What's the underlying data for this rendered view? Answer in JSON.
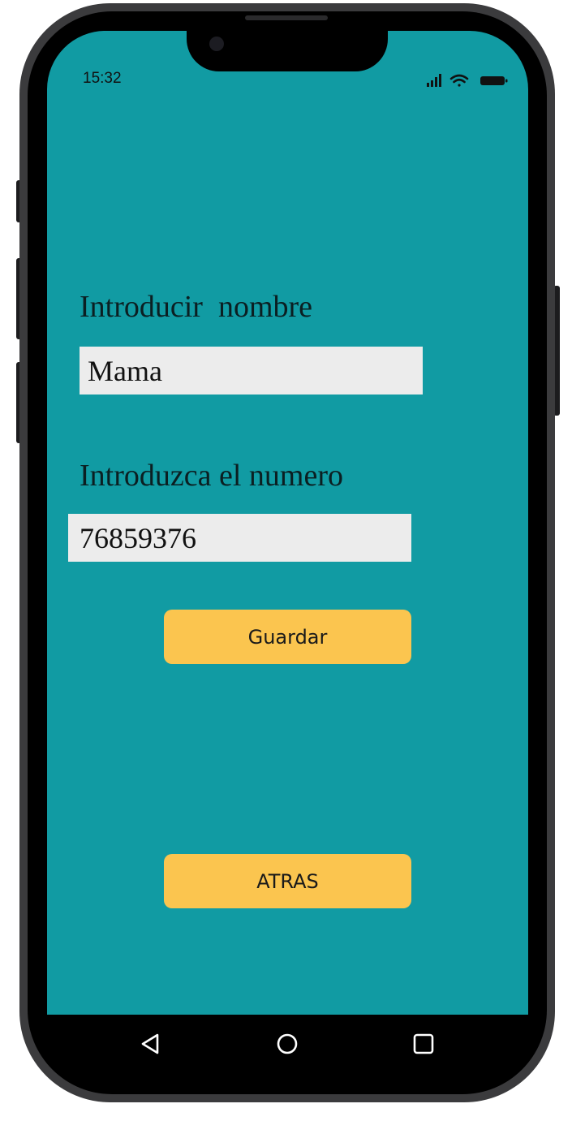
{
  "status_bar": {
    "time": "15:32",
    "icons": [
      "signal-icon",
      "wifi-icon",
      "battery-icon"
    ]
  },
  "form": {
    "name_label": "Introducir  nombre",
    "name_value": "Mama",
    "number_label": "Introduzca el numero",
    "number_value": "76859376"
  },
  "buttons": {
    "save_label": "Guardar",
    "back_label": "ATRAS"
  },
  "nav_bar": {
    "icons": [
      "back-triangle-icon",
      "home-circle-icon",
      "recent-square-icon"
    ]
  },
  "colors": {
    "screen_background": "#119ba3",
    "button_background": "#fbc54f",
    "field_background": "#ececec",
    "phone_frame": "#3b3b3d"
  }
}
